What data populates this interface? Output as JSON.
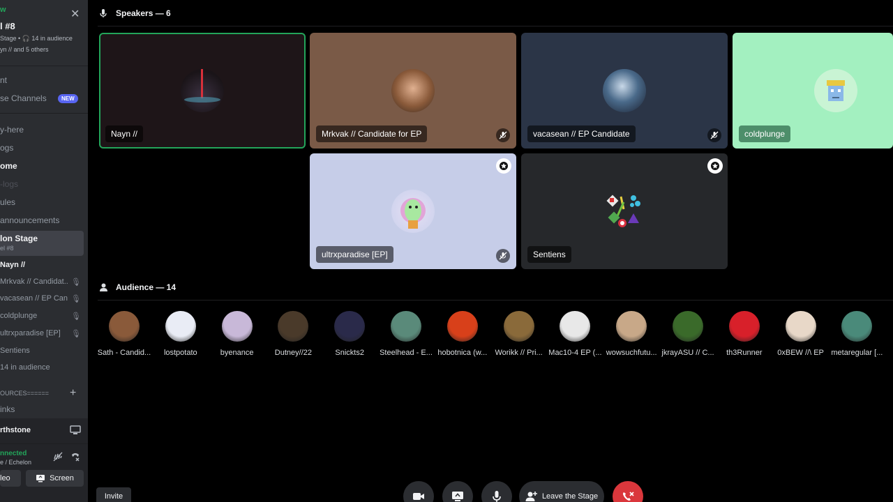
{
  "sidebar": {
    "top_partial": "w",
    "channel_partial": "l #8",
    "stage_info": "Stage • 🎧 14 in audience",
    "speakers_info": "yn // and 5 others",
    "item_nt": "nt",
    "browse_channels": "se Channels",
    "new_badge": "NEW",
    "channels": [
      "y-here",
      "ogs",
      "ome",
      "-logs",
      "ules",
      "announcements"
    ],
    "active_stage": "lon Stage",
    "active_stage_sub": "el #8",
    "speakers": [
      "Nayn //",
      "Mrkvak // Candidat...",
      "vacasean // EP Can...",
      "coldplunge",
      "ultrxparadise [EP]",
      "Sentiens"
    ],
    "audience_count": "14 in audience",
    "resources": "OURCES======",
    "links": "inks",
    "voice_channel": "rthstone",
    "connected": "nnected",
    "connected_sub": "e / Echelon",
    "video_btn": "leo",
    "screen_btn": "Screen"
  },
  "speakers_header": "Speakers — 6",
  "audience_header": "Audience — 14",
  "speakers": [
    {
      "name": "Nayn //",
      "bg": "#1e1518",
      "speaking": true,
      "muted": false,
      "mod": false
    },
    {
      "name": "Mrkvak // Candidate for EP",
      "bg": "#7a5a47",
      "speaking": false,
      "muted": true,
      "mod": false
    },
    {
      "name": "vacasean // EP Candidate",
      "bg": "#2b3547",
      "speaking": false,
      "muted": true,
      "mod": false
    },
    {
      "name": "coldplunge",
      "bg": "#a3f0c0",
      "speaking": false,
      "muted": false,
      "mod": false
    },
    {
      "name": "ultrxparadise [EP]",
      "bg": "#c6cde8",
      "speaking": false,
      "muted": true,
      "mod": true
    },
    {
      "name": "Sentiens",
      "bg": "#26282b",
      "speaking": false,
      "muted": false,
      "mod": true
    }
  ],
  "audience": [
    {
      "name": "Sath - Candid...",
      "color": "#8a5a3a"
    },
    {
      "name": "lostpotato",
      "color": "#e9ecf5"
    },
    {
      "name": "byenance",
      "color": "#c8b8d8"
    },
    {
      "name": "Dutney//22",
      "color": "#4a3a2a"
    },
    {
      "name": "Snickts2",
      "color": "#2a2a4a"
    },
    {
      "name": "Steelhead - E...",
      "color": "#5a8a7a"
    },
    {
      "name": "hobotnica (w...",
      "color": "#d8401a"
    },
    {
      "name": "Worikk // Pri...",
      "color": "#8a6a3a"
    },
    {
      "name": "Mac10-4 EP (...",
      "color": "#e8e8e8"
    },
    {
      "name": "wowsuchfutu...",
      "color": "#c8a888"
    },
    {
      "name": "jkrayASU // C...",
      "color": "#3a6a2a"
    },
    {
      "name": "th3Runner",
      "color": "#d8202a"
    },
    {
      "name": "0xBEW //\\ EP",
      "color": "#e8d8c8"
    },
    {
      "name": "metaregular [...",
      "color": "#4a8a7a"
    }
  ],
  "controls": {
    "invite": "Invite",
    "leave": "Leave the Stage"
  },
  "colors": {
    "speaking": "#23a55a",
    "danger": "#da373c",
    "sidebar": "#2b2d31"
  }
}
